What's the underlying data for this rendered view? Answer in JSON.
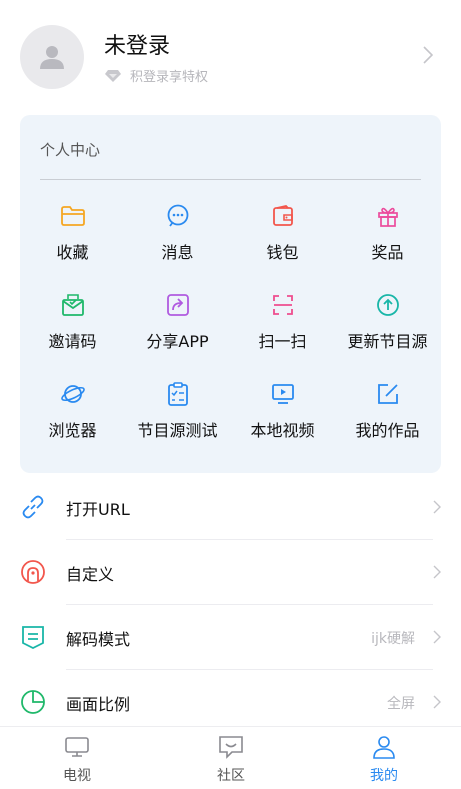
{
  "profile": {
    "username": "未登录",
    "privilege": "积登录享特权"
  },
  "personal_center": {
    "title": "个人中心",
    "items": [
      {
        "label": "收藏",
        "icon": "folder-icon",
        "color": "#f5a623"
      },
      {
        "label": "消息",
        "icon": "message-icon",
        "color": "#2a8af0"
      },
      {
        "label": "钱包",
        "icon": "wallet-icon",
        "color": "#f2564c"
      },
      {
        "label": "奖品",
        "icon": "gift-icon",
        "color": "#ec4b9c"
      },
      {
        "label": "邀请码",
        "icon": "invite-code-icon",
        "color": "#1fb86a"
      },
      {
        "label": "分享APP",
        "icon": "share-icon",
        "color": "#b05be0"
      },
      {
        "label": "扫一扫",
        "icon": "scan-icon",
        "color": "#ee4d8e"
      },
      {
        "label": "更新节目源",
        "icon": "update-source-icon",
        "color": "#19b6a8"
      },
      {
        "label": "浏览器",
        "icon": "browser-icon",
        "color": "#2a8af0"
      },
      {
        "label": "节目源测试",
        "icon": "source-test-icon",
        "color": "#2a8af0"
      },
      {
        "label": "本地视频",
        "icon": "local-video-icon",
        "color": "#2a8af0"
      },
      {
        "label": "我的作品",
        "icon": "my-works-icon",
        "color": "#2a8af0"
      }
    ]
  },
  "settings": [
    {
      "label": "打开URL",
      "value": "",
      "icon": "link-icon",
      "color": "#2a8af0"
    },
    {
      "label": "自定义",
      "value": "",
      "icon": "custom-icon",
      "color": "#f2564c"
    },
    {
      "label": "解码模式",
      "value": "ijk硬解",
      "icon": "decode-icon",
      "color": "#19b6a8"
    },
    {
      "label": "画面比例",
      "value": "全屏",
      "icon": "aspect-ratio-icon",
      "color": "#1fb86a"
    }
  ],
  "bottom_nav": [
    {
      "label": "电视",
      "icon": "tv-icon",
      "active": false
    },
    {
      "label": "社区",
      "icon": "community-icon",
      "active": false
    },
    {
      "label": "我的",
      "icon": "profile-icon",
      "active": true
    }
  ],
  "colors": {
    "accent": "#2a8af0",
    "card_bg": "#eef4fa"
  }
}
